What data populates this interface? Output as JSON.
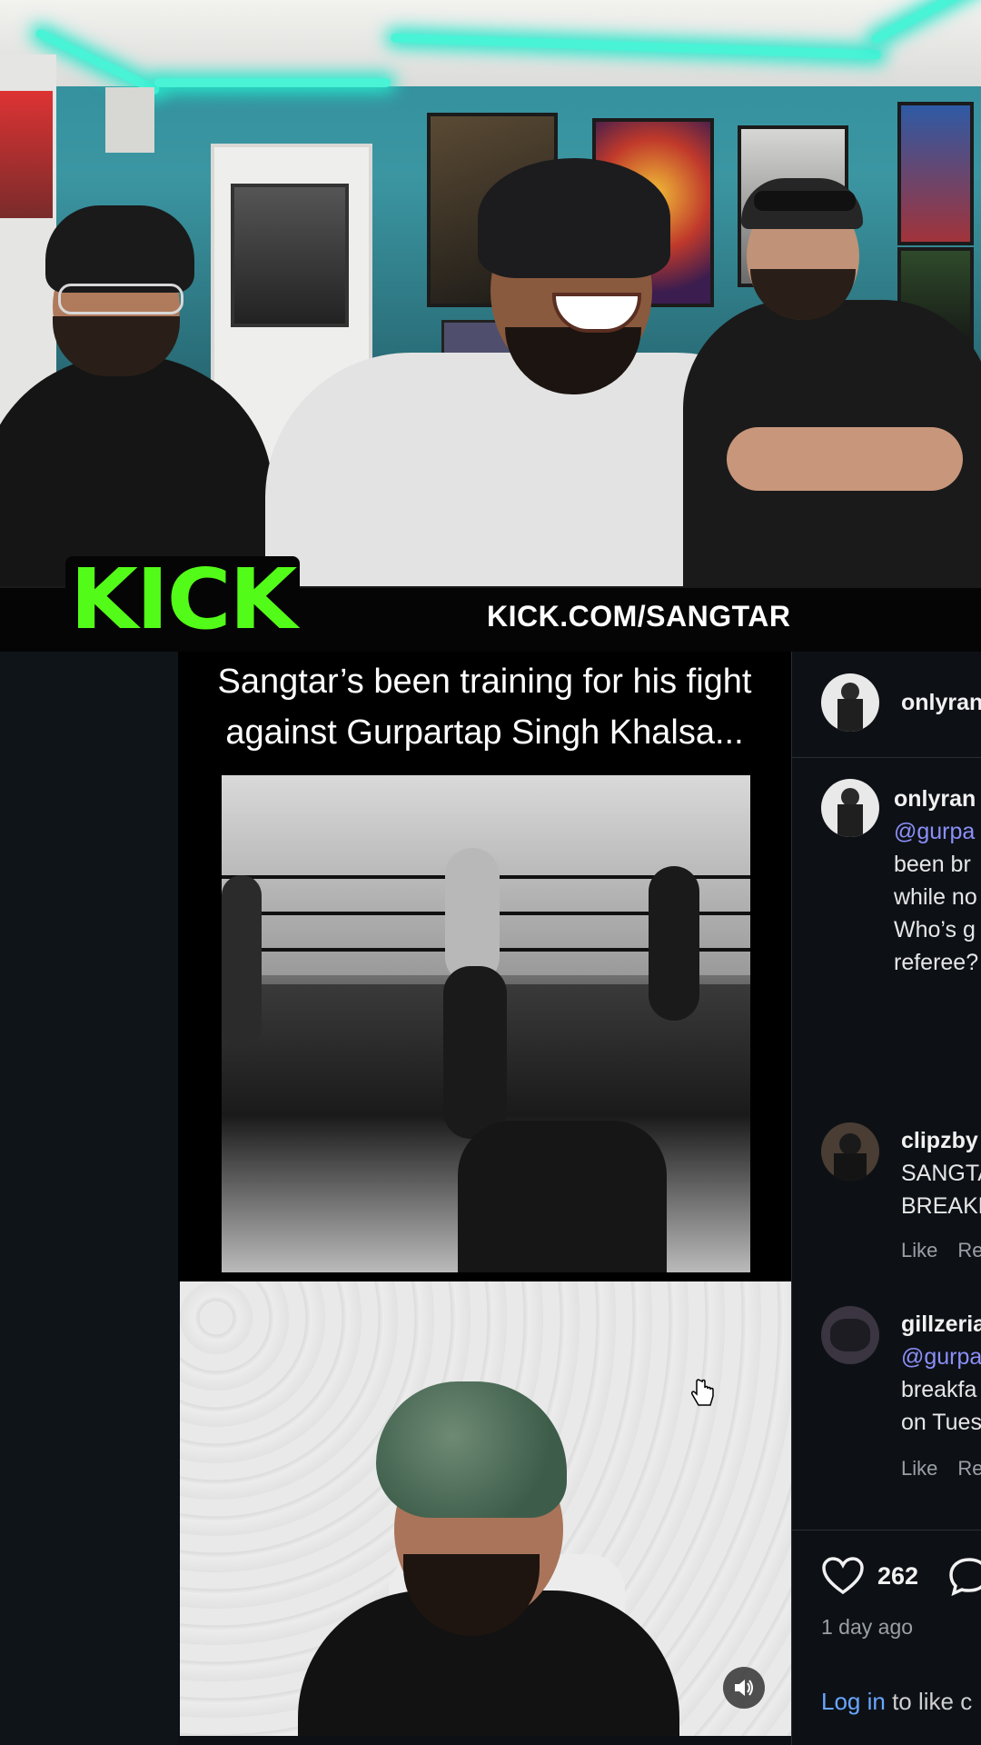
{
  "banner": {
    "logo_text": "KICK",
    "url": "KICK.COM/SANGTAR",
    "accent": "#53fc18"
  },
  "video": {
    "caption": "Sangtar’s been training for his fight against Gurpartap Singh Khalsa..."
  },
  "post": {
    "header_username": "onlyran",
    "comments": [
      {
        "username": "onlyran",
        "lines": [
          "@gurpa",
          "been br",
          "while no",
          "Who’s g",
          "referee?"
        ],
        "mention": "@gurpa"
      },
      {
        "username": "clipzby",
        "lines": [
          "SANGTA",
          "BREAKF"
        ],
        "actions": [
          "Like",
          "Re"
        ]
      },
      {
        "username": "gillzeria",
        "lines": [
          "@gurpa",
          "breakfa",
          "on Tues"
        ],
        "mention": "@gurpa",
        "actions": [
          "Like",
          "Re"
        ]
      }
    ],
    "likes": "262",
    "time_ago": "1 day ago",
    "login_link": "Log in",
    "login_rest": "to like c"
  },
  "icons": {
    "heart": "heart-icon",
    "comment": "comment-icon",
    "volume": "volume-icon",
    "cursor": "hand-cursor-icon"
  }
}
